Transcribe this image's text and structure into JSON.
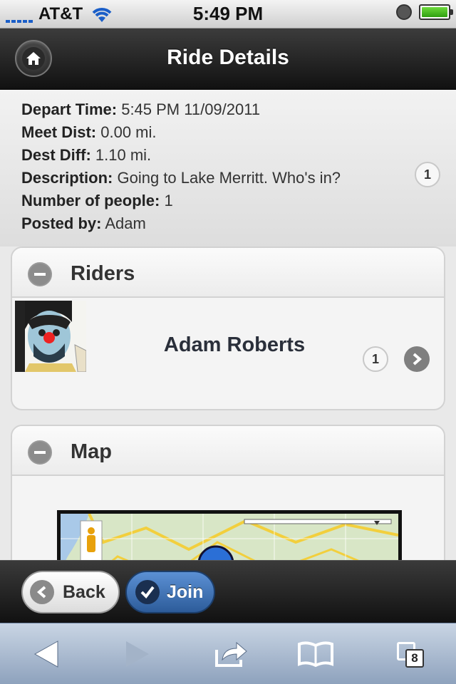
{
  "status_bar": {
    "carrier": "AT&T",
    "time": "5:49 PM"
  },
  "header": {
    "title": "Ride Details",
    "home_icon": "home-icon"
  },
  "details": {
    "rows": [
      {
        "label": "Depart Time:",
        "value": "5:45 PM 11/09/2011"
      },
      {
        "label": "Meet Dist:",
        "value": "0.00 mi."
      },
      {
        "label": "Dest Diff:",
        "value": "1.10 mi."
      },
      {
        "label": "Description:",
        "value": "Going to Lake Merritt. Who's in?"
      },
      {
        "label": "Number of people:",
        "value": "1"
      },
      {
        "label": "Posted by:",
        "value": "Adam"
      }
    ],
    "count": "1"
  },
  "riders": {
    "title": "Riders",
    "items": [
      {
        "name": "Adam Roberts",
        "count": "1"
      }
    ]
  },
  "map": {
    "title": "Map"
  },
  "toolbar": {
    "back_label": "Back",
    "join_label": "Join"
  },
  "safari": {
    "tab_count": "8"
  },
  "colors": {
    "header_bg": "#1a1a1a",
    "join_blue": "#3f74b8",
    "signal_blue": "#1a5ec8",
    "safari_bar": "#a6b6cc"
  }
}
